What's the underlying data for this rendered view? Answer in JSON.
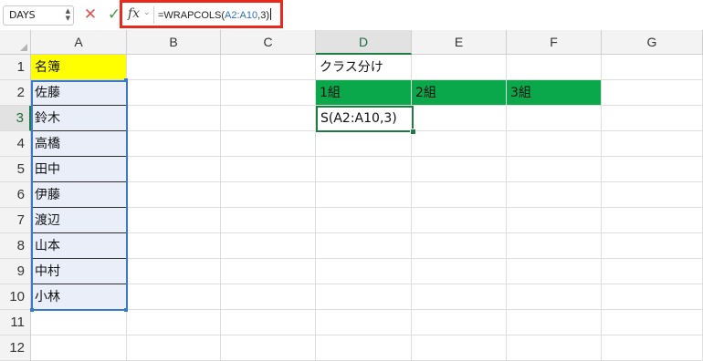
{
  "formula_bar": {
    "name_box": "DAYS",
    "fx_label": "fx",
    "formula_prefix": "=WRAPCOLS(",
    "formula_ref": "A2:A10",
    "formula_suffix": ",3)"
  },
  "columns": [
    "A",
    "B",
    "C",
    "D",
    "E",
    "F",
    "G"
  ],
  "rows": [
    "1",
    "2",
    "3",
    "4",
    "5",
    "6",
    "7",
    "8",
    "9",
    "10",
    "11",
    "12"
  ],
  "cells": {
    "A1": "名簿",
    "A2": "佐藤",
    "A3": "鈴木",
    "A4": "高橋",
    "A5": "田中",
    "A6": "伊藤",
    "A7": "渡辺",
    "A8": "山本",
    "A9": "中村",
    "A10": "小林",
    "D1": "クラス分け",
    "D2": "1組",
    "E2": "2組",
    "F2": "3組",
    "D3": "S(A2:A10,3)"
  },
  "colors": {
    "header_fill": "#ffff00",
    "class_fill": "#0aa84b",
    "range_fill": "#e9eef9",
    "highlight": "#e8291c"
  }
}
